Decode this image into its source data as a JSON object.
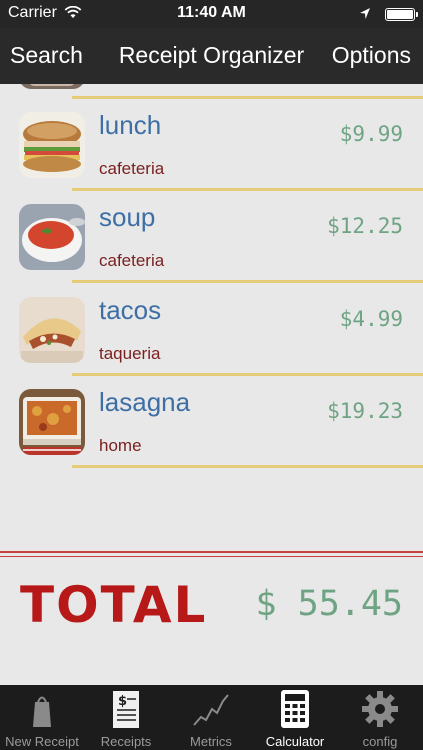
{
  "status_bar": {
    "carrier": "Carrier",
    "time": "11:40 AM"
  },
  "nav": {
    "left_label": "Search",
    "title": "Receipt Organizer",
    "right_label": "Options"
  },
  "receipts": [
    {
      "name": "lunch",
      "place": "cafeteria",
      "amount": "$9.99",
      "image": "sandwich-image"
    },
    {
      "name": "soup",
      "place": "cafeteria",
      "amount": "$12.25",
      "image": "soup-image"
    },
    {
      "name": "tacos",
      "place": "taqueria",
      "amount": "$4.99",
      "image": "tacos-image"
    },
    {
      "name": "lasagna",
      "place": "home",
      "amount": "$19.23",
      "image": "lasagna-image"
    }
  ],
  "total": {
    "label": "TOTAL",
    "value": "$ 55.45"
  },
  "tabs": [
    {
      "label": "New Receipt",
      "icon": "bag-icon",
      "active": false
    },
    {
      "label": "Receipts",
      "icon": "receipt-icon",
      "active": false
    },
    {
      "label": "Metrics",
      "icon": "chart-icon",
      "active": false
    },
    {
      "label": "Calculator",
      "icon": "calculator-icon",
      "active": true
    },
    {
      "label": "config",
      "icon": "gear-icon",
      "active": false
    }
  ],
  "colors": {
    "nav_bg": "#2a2a2a",
    "content_bg": "#e8e8e8",
    "item_name": "#3d6fa6",
    "item_place": "#7a1f1f",
    "amount": "#6ea483",
    "divider": "#e4cc78",
    "total_label": "#b71818",
    "red_rule": "#c94040"
  }
}
